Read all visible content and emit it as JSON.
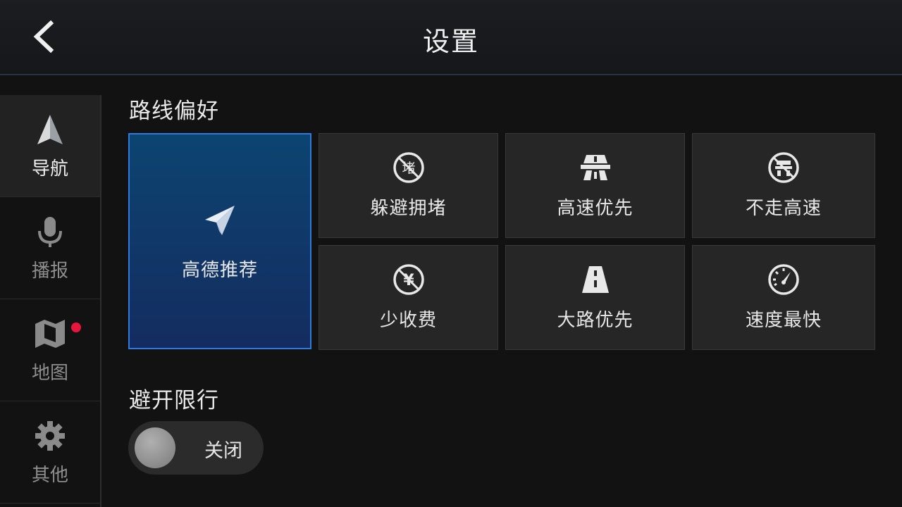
{
  "header": {
    "title": "设置",
    "back_icon": "chevron-left-icon"
  },
  "sidebar": {
    "items": [
      {
        "label": "导航",
        "icon": "navigation-arrow-icon",
        "active": true
      },
      {
        "label": "播报",
        "icon": "microphone-icon",
        "active": false
      },
      {
        "label": "地图",
        "icon": "map-icon",
        "active": false,
        "badge": "red-dot"
      },
      {
        "label": "其他",
        "icon": "gear-icon",
        "active": false
      }
    ]
  },
  "route_preference": {
    "title": "路线偏好",
    "options": [
      {
        "label": "高德推荐",
        "icon": "paper-plane-icon",
        "selected": true
      },
      {
        "label": "躲避拥堵",
        "icon": "avoid-congestion-icon",
        "icon_char": "堵"
      },
      {
        "label": "高速优先",
        "icon": "highway-icon"
      },
      {
        "label": "不走高速",
        "icon": "no-highway-icon"
      },
      {
        "label": "少收费",
        "icon": "no-toll-icon",
        "icon_char": "¥"
      },
      {
        "label": "大路优先",
        "icon": "main-road-icon"
      },
      {
        "label": "速度最快",
        "icon": "speedometer-icon"
      }
    ]
  },
  "avoid_restriction": {
    "title": "避开限行",
    "toggle_label": "关闭",
    "enabled": false
  },
  "colors": {
    "accent": "#2f7bdd",
    "selected_bg": "#0c4470",
    "badge": "#e8163c"
  }
}
